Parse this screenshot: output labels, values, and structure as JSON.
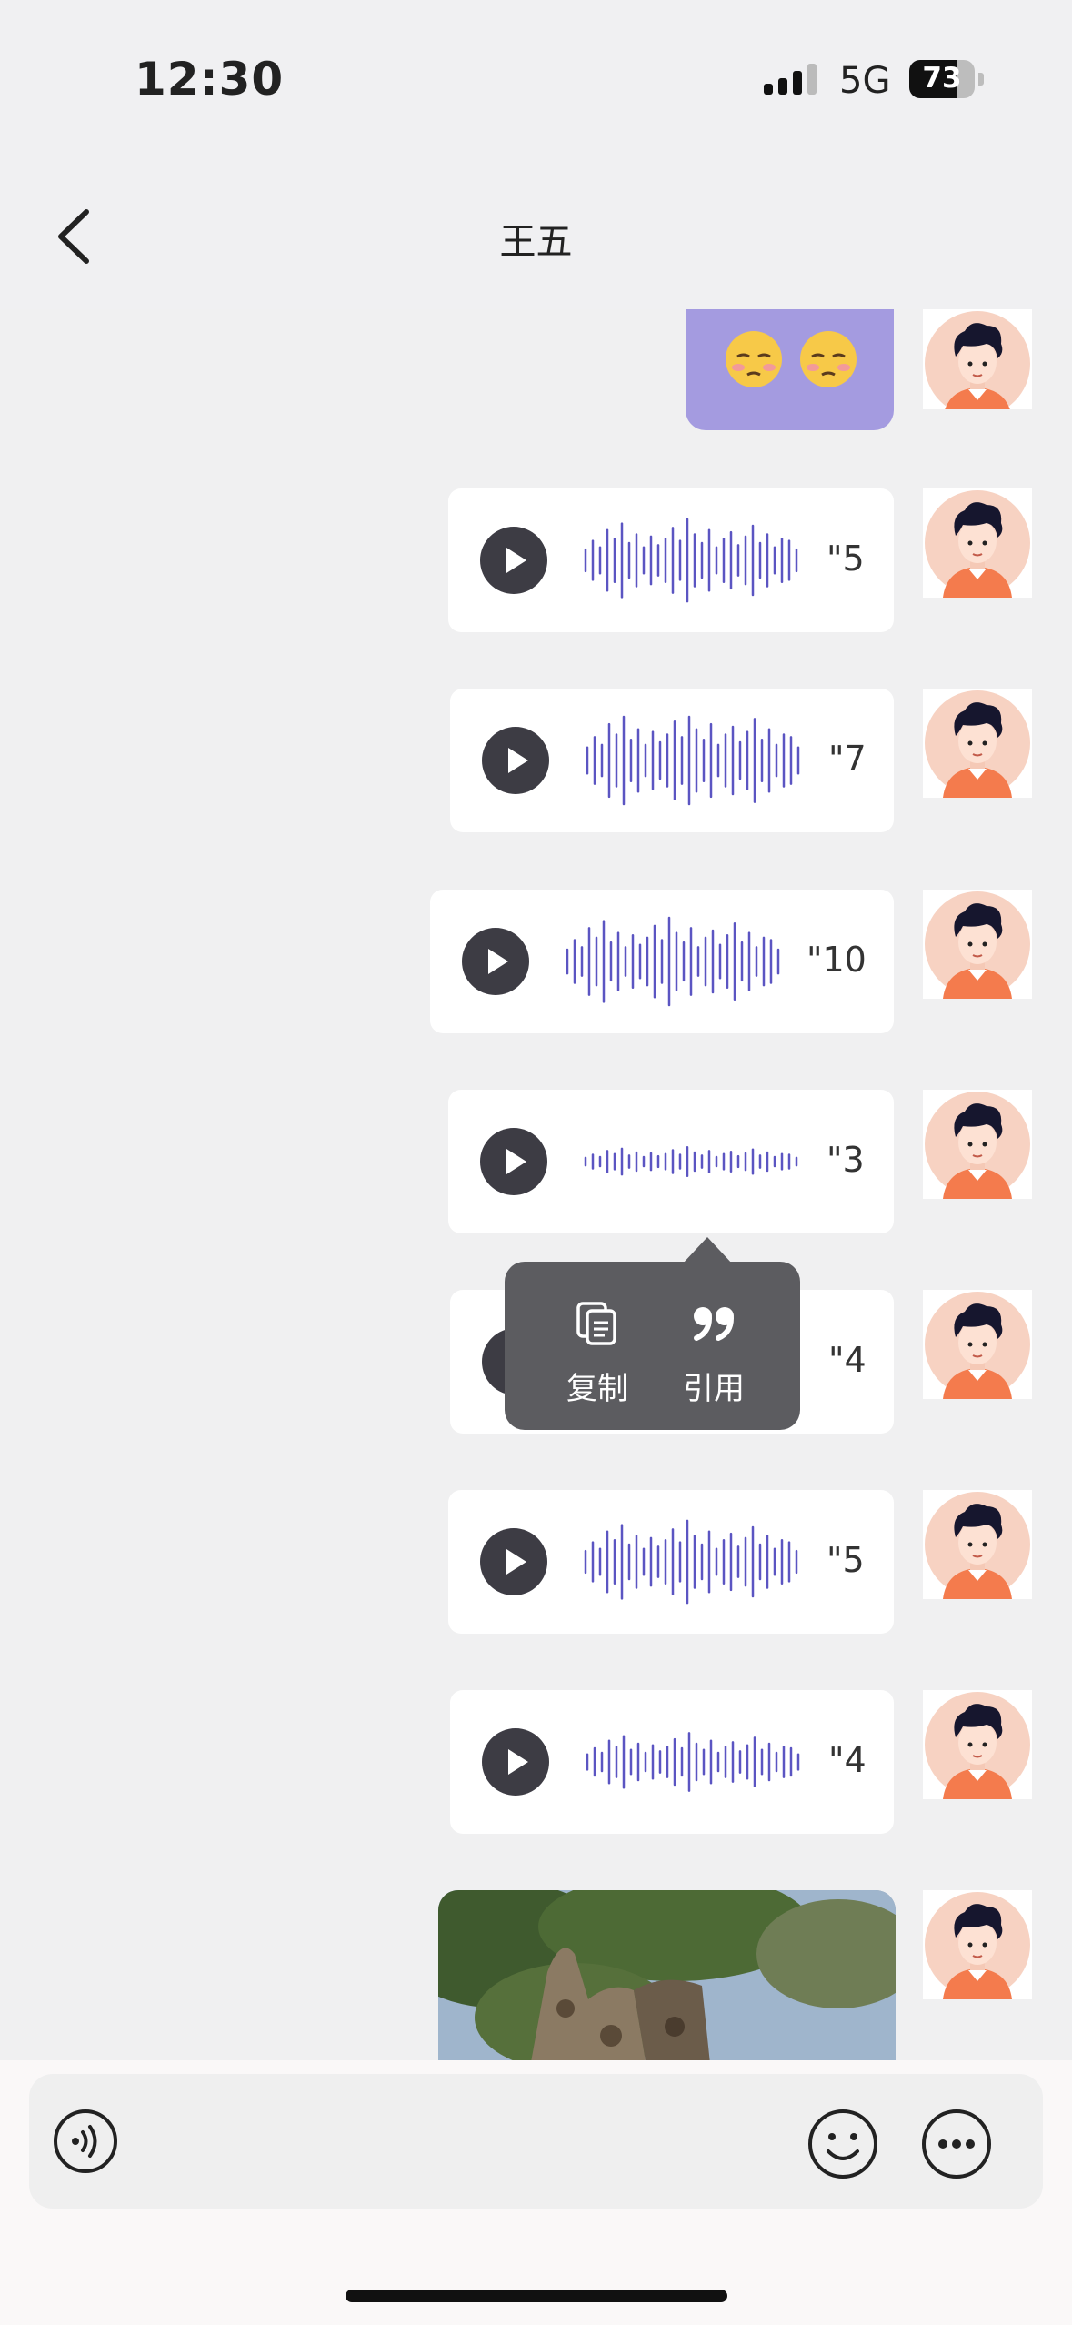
{
  "status_bar": {
    "time": "12:30",
    "network": "5G",
    "battery": "73"
  },
  "header": {
    "title": "王五"
  },
  "popup": {
    "copy_label": "复制",
    "quote_label": "引用"
  },
  "messages": [
    {
      "type": "emoji",
      "count": 2
    },
    {
      "type": "voice",
      "duration": "\"5"
    },
    {
      "type": "voice",
      "duration": "\"7"
    },
    {
      "type": "voice",
      "duration": "\"10"
    },
    {
      "type": "voice",
      "duration": "\"3"
    },
    {
      "type": "voice",
      "duration": "\"4"
    },
    {
      "type": "voice",
      "duration": "\"5"
    },
    {
      "type": "voice",
      "duration": "\"4"
    },
    {
      "type": "image"
    }
  ],
  "colors": {
    "accent": "#a49be0",
    "wave": "#5b55c2",
    "play": "#3d3c44",
    "popup": "#5c5c60"
  }
}
